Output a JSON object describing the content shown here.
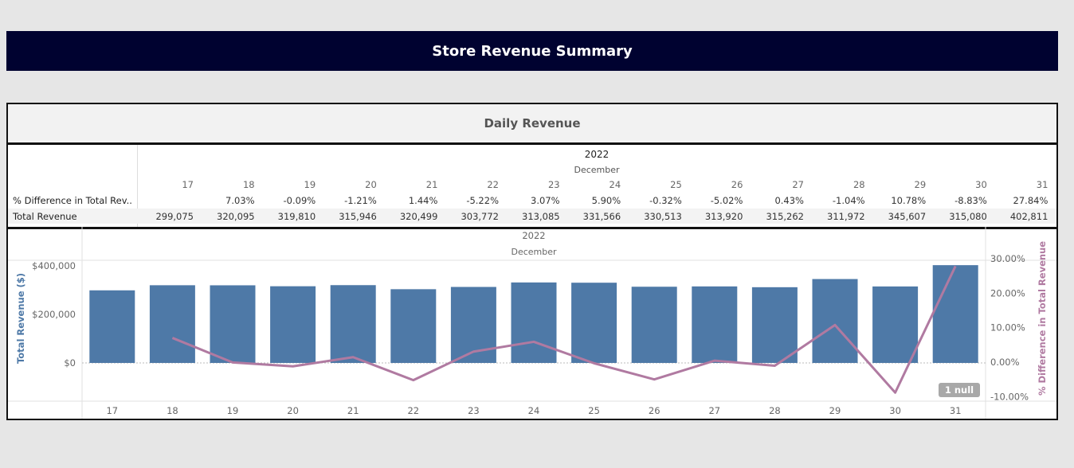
{
  "page": {
    "title": "Store Revenue Summary"
  },
  "panel": {
    "title": "Daily Revenue"
  },
  "table": {
    "year": "2022",
    "month": "December",
    "days": [
      "17",
      "18",
      "19",
      "20",
      "21",
      "22",
      "23",
      "24",
      "25",
      "26",
      "27",
      "28",
      "29",
      "30",
      "31"
    ],
    "rows": [
      {
        "label": "% Difference in Total Rev..",
        "values": [
          "",
          "7.03%",
          "-0.09%",
          "-1.21%",
          "1.44%",
          "-5.22%",
          "3.07%",
          "5.90%",
          "-0.32%",
          "-5.02%",
          "0.43%",
          "-1.04%",
          "10.78%",
          "-8.83%",
          "27.84%"
        ]
      },
      {
        "label": "Total Revenue",
        "values": [
          "299,075",
          "320,095",
          "319,810",
          "315,946",
          "320,499",
          "303,772",
          "313,085",
          "331,566",
          "330,513",
          "313,920",
          "315,262",
          "311,972",
          "345,607",
          "315,080",
          "402,811"
        ]
      }
    ]
  },
  "chart_data": {
    "type": "bar",
    "header_year": "2022",
    "header_month": "December",
    "categories": [
      "17",
      "18",
      "19",
      "20",
      "21",
      "22",
      "23",
      "24",
      "25",
      "26",
      "27",
      "28",
      "29",
      "30",
      "31"
    ],
    "series": [
      {
        "name": "Total Revenue",
        "axis": "left",
        "mark": "bar",
        "color": "#4e79a7",
        "values": [
          299075,
          320095,
          319810,
          315946,
          320499,
          303772,
          313085,
          331566,
          330513,
          313920,
          315262,
          311972,
          345607,
          315080,
          402811
        ]
      },
      {
        "name": "% Difference in Total Revenue",
        "axis": "right",
        "mark": "line",
        "color": "#b07aa1",
        "values": [
          null,
          7.03,
          -0.09,
          -1.21,
          1.44,
          -5.22,
          3.07,
          5.9,
          -0.32,
          -5.02,
          0.43,
          -1.04,
          10.78,
          -8.83,
          27.84
        ]
      }
    ],
    "ylabel": "Total Revenue ($)",
    "y2label": "% Difference in Total Revenue",
    "yticks": [
      "$400,000",
      "$200,000",
      "$0"
    ],
    "y2ticks": [
      "30.00%",
      "20.00%",
      "10.00%",
      "0.00%",
      "-10.00%"
    ],
    "null_badge": "1 null"
  }
}
